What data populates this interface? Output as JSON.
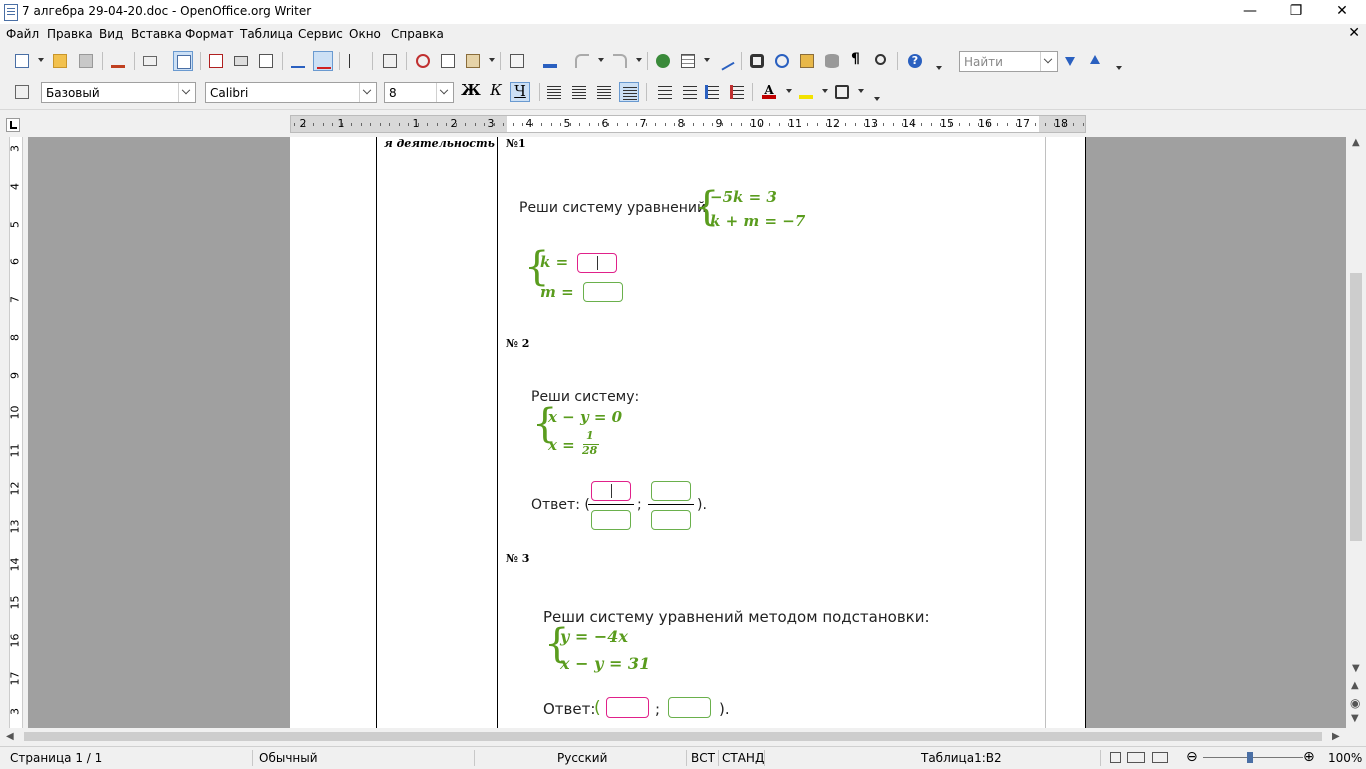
{
  "window": {
    "title": "7 алгебра 29-04-20.doc - OpenOffice.org Writer"
  },
  "menu": [
    "Файл",
    "Правка",
    "Вид",
    "Вставка",
    "Формат",
    "Таблица",
    "Сервис",
    "Окно",
    "Справка"
  ],
  "toolbar": {
    "find_placeholder": "Найти"
  },
  "format_toolbar": {
    "style": "Базовый",
    "font": "Calibri",
    "size": "8",
    "bold": "Ж",
    "italic": "К",
    "underline": "Ч"
  },
  "ruler": {
    "labels": [
      "2",
      "1",
      "1",
      "2",
      "3",
      "4",
      "5",
      "6",
      "7",
      "8",
      "9",
      "10",
      "11",
      "12",
      "13",
      "14",
      "15",
      "16",
      "17",
      "18"
    ]
  },
  "vruler": {
    "labels": [
      "3",
      "4",
      "5",
      "6",
      "7",
      "8",
      "9",
      "10",
      "11",
      "12",
      "13",
      "14",
      "15",
      "16",
      "17",
      "3"
    ]
  },
  "document": {
    "left_cell": "я деятельность",
    "task1": {
      "number": "№1",
      "prompt": "Реши систему уравнений",
      "eq1": "−5k = 3",
      "eq2": "k + m  =  −7",
      "ans1_label": "k =",
      "ans2_label": "m ="
    },
    "task2": {
      "number": "№ 2",
      "prompt": "Реши систему:",
      "eq1": "x − y = 0",
      "eq2_left": "x =",
      "frac_num": "1",
      "frac_den": "28",
      "answer_label": "Ответ: (",
      "semicolon": ";",
      "close": ")."
    },
    "task3": {
      "number": "№ 3",
      "prompt": "Реши систему уравнений методом подстановки:",
      "eq1": "y = −4x",
      "eq2": "x − y = 31",
      "answer_label": "Ответ:",
      "open": "(",
      "semicolon": ";",
      "close": ")."
    }
  },
  "status": {
    "page": "Страница  1 / 1",
    "style": "Обычный",
    "language": "Русский",
    "insert_mode": "ВСТ",
    "selection_mode": "СТАНД",
    "cell": "Таблица1:B2",
    "zoom": "100%"
  },
  "colors": {
    "math_green": "#5a9c1e",
    "box_green": "#6ab04c",
    "box_pink": "#e0218a"
  }
}
